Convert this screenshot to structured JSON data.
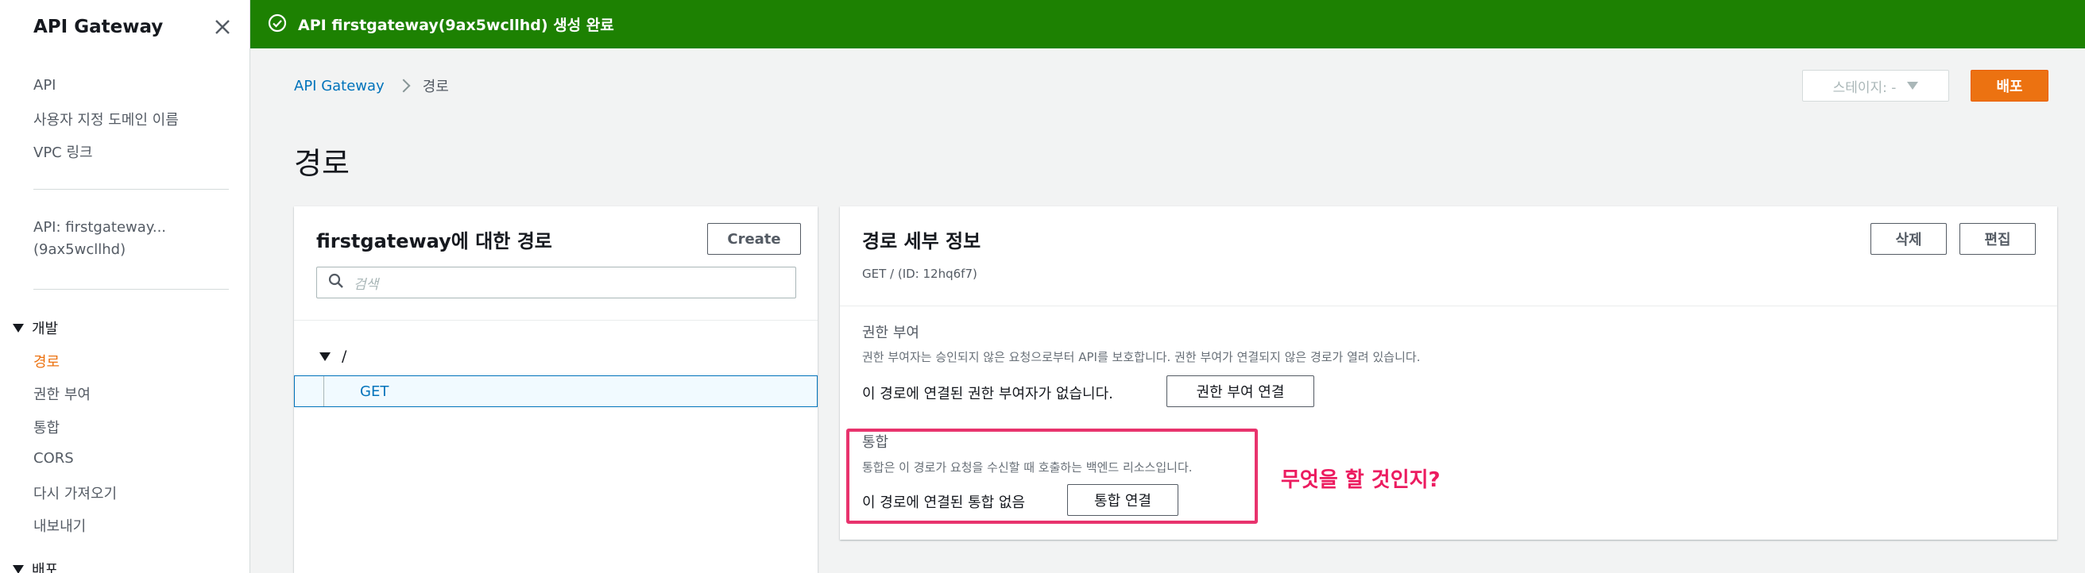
{
  "sidebar": {
    "title": "API Gateway",
    "links": [
      "API",
      "사용자 지정 도메인 이름",
      "VPC 링크"
    ],
    "api_name_line1": "API: firstgateway...",
    "api_name_line2": "(9ax5wcllhd)",
    "dev_section": "개발",
    "dev_items": [
      "경로",
      "권한 부여",
      "통합",
      "CORS",
      "다시 가져오기",
      "내보내기"
    ],
    "deploy_section": "배포"
  },
  "banner": {
    "message": "API firstgateway(9ax5wcllhd) 생성 완료",
    "color": "#1d8102"
  },
  "breadcrumb": {
    "root": "API Gateway",
    "current": "경로"
  },
  "header": {
    "stage_label": "스테이지: -",
    "deploy_label": "배포",
    "page_title": "경로"
  },
  "routes_panel": {
    "title": "firstgateway에 대한 경로",
    "create_label": "Create",
    "search_placeholder": "검색",
    "root_path": "/",
    "method": "GET"
  },
  "details_panel": {
    "title": "경로 세부 정보",
    "delete_label": "삭제",
    "edit_label": "편집",
    "subtitle": "GET / (ID: 12hq6f7)",
    "authorization": {
      "label": "권한 부여",
      "description": "권한 부여자는 승인되지 않은 요청으로부터 API를 보호합니다. 권한 부여가 연결되지 않은 경로가 열려 있습니다.",
      "status": "이 경로에 연결된 권한 부여자가 없습니다.",
      "button": "권한 부여 연결"
    },
    "integration": {
      "label": "통합",
      "description": "통합은 이 경로가 요청을 수신할 때 호출하는 백엔드 리소스입니다.",
      "status": "이 경로에 연결된 통합 없음",
      "button": "통합 연결"
    }
  },
  "annotation": {
    "text": "무엇을 할 것인지?",
    "color": "#ec1c60"
  },
  "accent_color": "#ec7211"
}
